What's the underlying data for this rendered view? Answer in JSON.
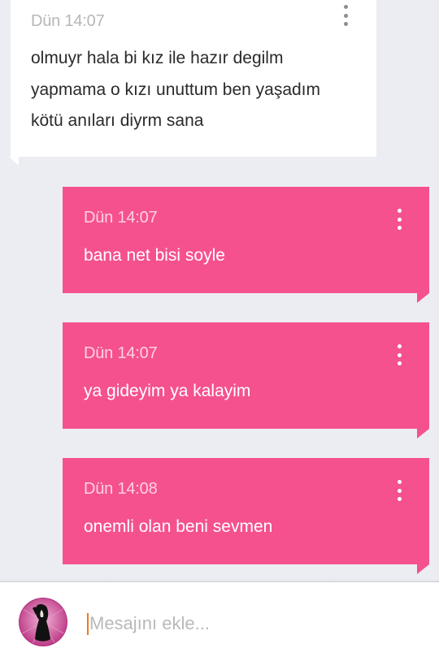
{
  "messages": [
    {
      "direction": "incoming",
      "time": "Dün 14:07",
      "lines": [
        "olmuyr hala bi kız ile hazır degilm",
        "yapmama o kızı unuttum ben yaşadım",
        "kötü anıları diyrm sana"
      ]
    },
    {
      "direction": "outgoing",
      "time": "Dün 14:07",
      "text": "bana net bisi soyle"
    },
    {
      "direction": "outgoing",
      "time": "Dün 14:07",
      "text": "ya gideyim ya kalayim"
    },
    {
      "direction": "outgoing",
      "time": "Dün 14:08",
      "text": "onemli olan beni sevmen"
    }
  ],
  "composer": {
    "placeholder": "Mesajını ekle...",
    "value": ""
  },
  "icons": {
    "message_menu": "more-vertical-icon",
    "avatar": "user-avatar"
  },
  "colors": {
    "outgoing_bubble": "#f5518f",
    "incoming_bubble": "#ffffff",
    "background": "#ecedf2",
    "caret": "#f07a19"
  }
}
